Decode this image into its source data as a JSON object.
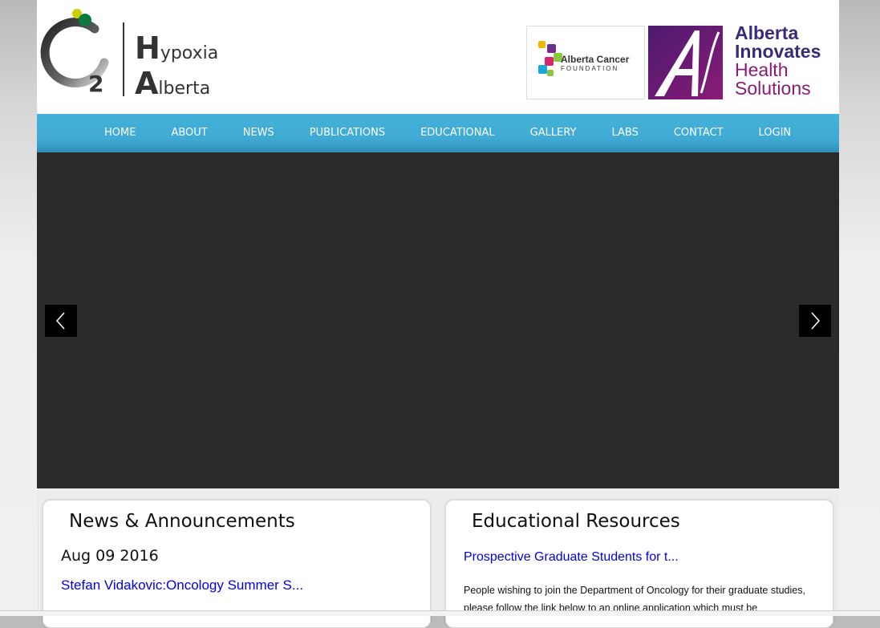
{
  "logo": {
    "subscript": "2",
    "line1_cap": "H",
    "line1_rest": "ypoxia",
    "line2_cap": "A",
    "line2_rest": "lberta"
  },
  "sponsors": {
    "acf": {
      "line1": "Alberta Cancer",
      "line2": "FOUNDATION"
    },
    "aihs": {
      "line1": "Alberta",
      "line2": "Innovates",
      "line3": "Health",
      "line4": "Solutions"
    }
  },
  "nav": {
    "items": [
      "HOME",
      "ABOUT",
      "NEWS",
      "PUBLICATIONS",
      "EDUCATIONAL",
      "GALLERY",
      "LABS",
      "CONTACT",
      "LOGIN"
    ]
  },
  "news": {
    "title": "News & Announcements",
    "date": "Aug 09 2016",
    "link": "Stefan Vidakovic:Oncology Summer S..."
  },
  "education": {
    "title": "Educational Resources",
    "link": "Prospective Graduate Students for t...",
    "body": "People wishing to join the Department of Oncology for their graduate studies, please follow the link below to an online application which must be"
  },
  "colors": {
    "nav": "#3faad3",
    "slider": "#2b2929",
    "link": "#0000ee",
    "aihs_primary": "#3a2a7a",
    "aihs_secondary": "#8a1b78",
    "logo_green_dot": "#0a7a3e",
    "logo_yellow_dot": "#c8d200"
  },
  "icons": {
    "prev": "chevron-left-icon",
    "next": "chevron-right-icon"
  }
}
